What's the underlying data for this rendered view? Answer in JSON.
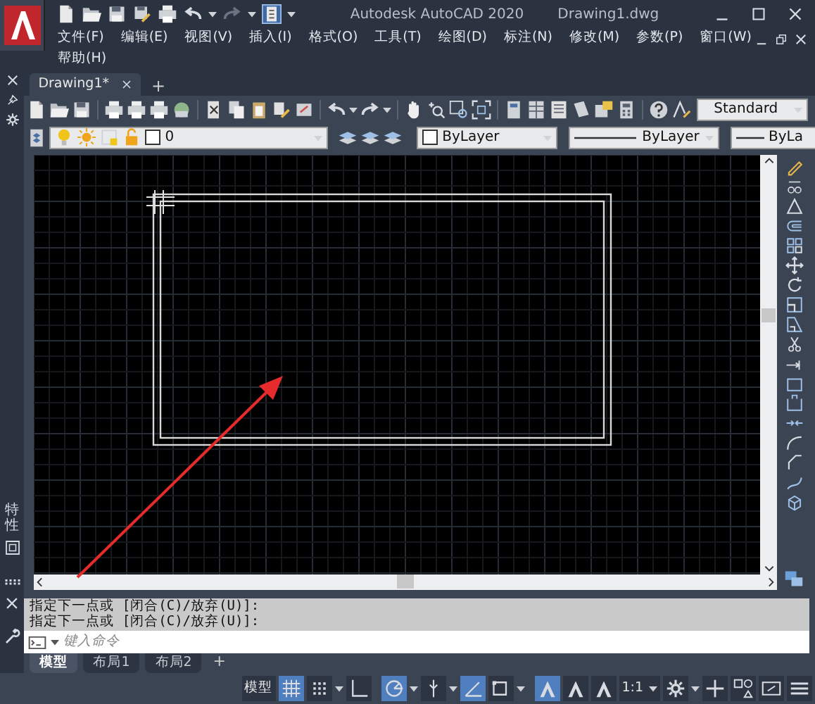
{
  "title": "Autodesk AutoCAD 2020",
  "file_name": "Drawing1.dwg",
  "menu_rows": [
    [
      "文件(F)",
      "编辑(E)",
      "视图(V)",
      "插入(I)",
      "格式(O)",
      "工具(T)",
      "绘图(D)",
      "标注(N)",
      "修改(M)",
      "参数(P)",
      "窗口(W)"
    ],
    [
      "帮助(H)"
    ]
  ],
  "doc_tabs": [
    {
      "label": "Drawing1*",
      "selected": true
    }
  ],
  "new_tab": "+",
  "text_style": "Standard",
  "layer": "0",
  "color_setting": "ByLayer",
  "linetype": "ByLayer",
  "lineweight": "ByLa",
  "palette_label": "特性",
  "command_history": [
    "指定下一点或 [闭合(C)/放弃(U)]:",
    "指定下一点或 [闭合(C)/放弃(U)]:"
  ],
  "command_input": {
    "placeholder": "键入命令"
  },
  "layout_tabs": [
    {
      "label": "模型",
      "selected": true
    },
    {
      "label": "布局1",
      "selected": false
    },
    {
      "label": "布局2",
      "selected": false
    }
  ],
  "new_layout": "+",
  "status_bar": {
    "model_button": "模型",
    "scale": "1:1",
    "toggles": [
      {
        "on": true
      },
      {
        "on": false
      },
      {
        "on": false
      },
      {
        "on": true
      },
      {
        "on": false
      },
      {
        "on": true
      },
      {
        "on": false
      },
      {
        "on": true
      },
      {
        "on": false
      },
      {
        "on": false
      }
    ]
  }
}
